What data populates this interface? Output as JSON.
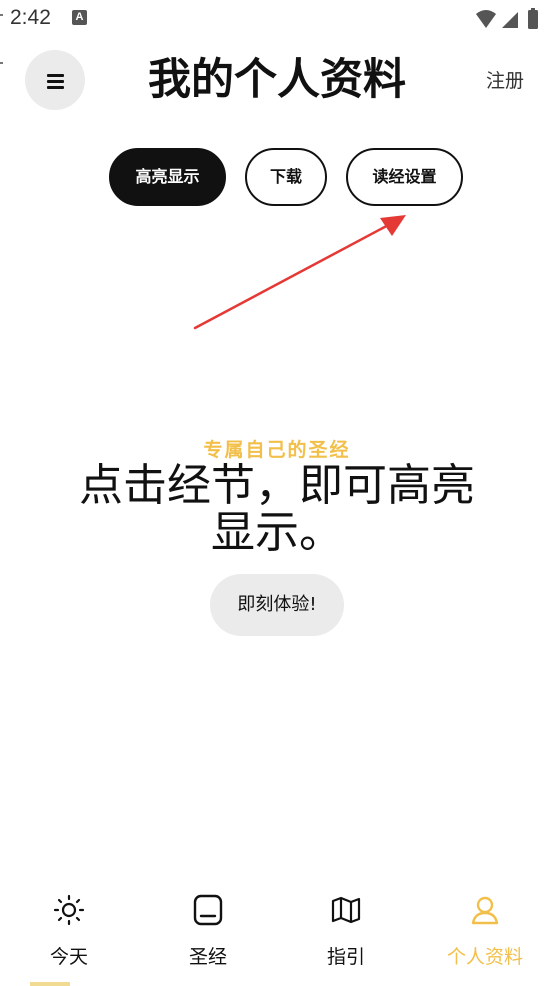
{
  "status_bar": {
    "time": "2:42",
    "notification_glyph": "A",
    "icons": [
      "wifi-icon",
      "signal-icon",
      "battery-icon"
    ]
  },
  "header": {
    "title": "我的个人资料",
    "menu_icon": "hamburger-menu-icon",
    "register_label": "注册"
  },
  "segments": [
    {
      "label": "高亮显示",
      "selected": true
    },
    {
      "label": "下载",
      "selected": false
    },
    {
      "label": "读经设置",
      "selected": false
    }
  ],
  "hero": {
    "kicker": "专属自己的圣经",
    "title": "点击经节，即可高亮显示。",
    "button_label": "即刻体验!"
  },
  "bottom_nav": [
    {
      "label": "今天",
      "icon": "sun-icon",
      "active": false
    },
    {
      "label": "圣经",
      "icon": "bible-book-icon",
      "active": false
    },
    {
      "label": "指引",
      "icon": "map-icon",
      "active": false
    },
    {
      "label": "个人资料",
      "icon": "profile-icon",
      "active": true
    }
  ],
  "colors": {
    "accent": "#f2c04a",
    "selected_segment": "#111111",
    "annotation_arrow": "#e53935",
    "soft_button": "#ebebeb"
  }
}
